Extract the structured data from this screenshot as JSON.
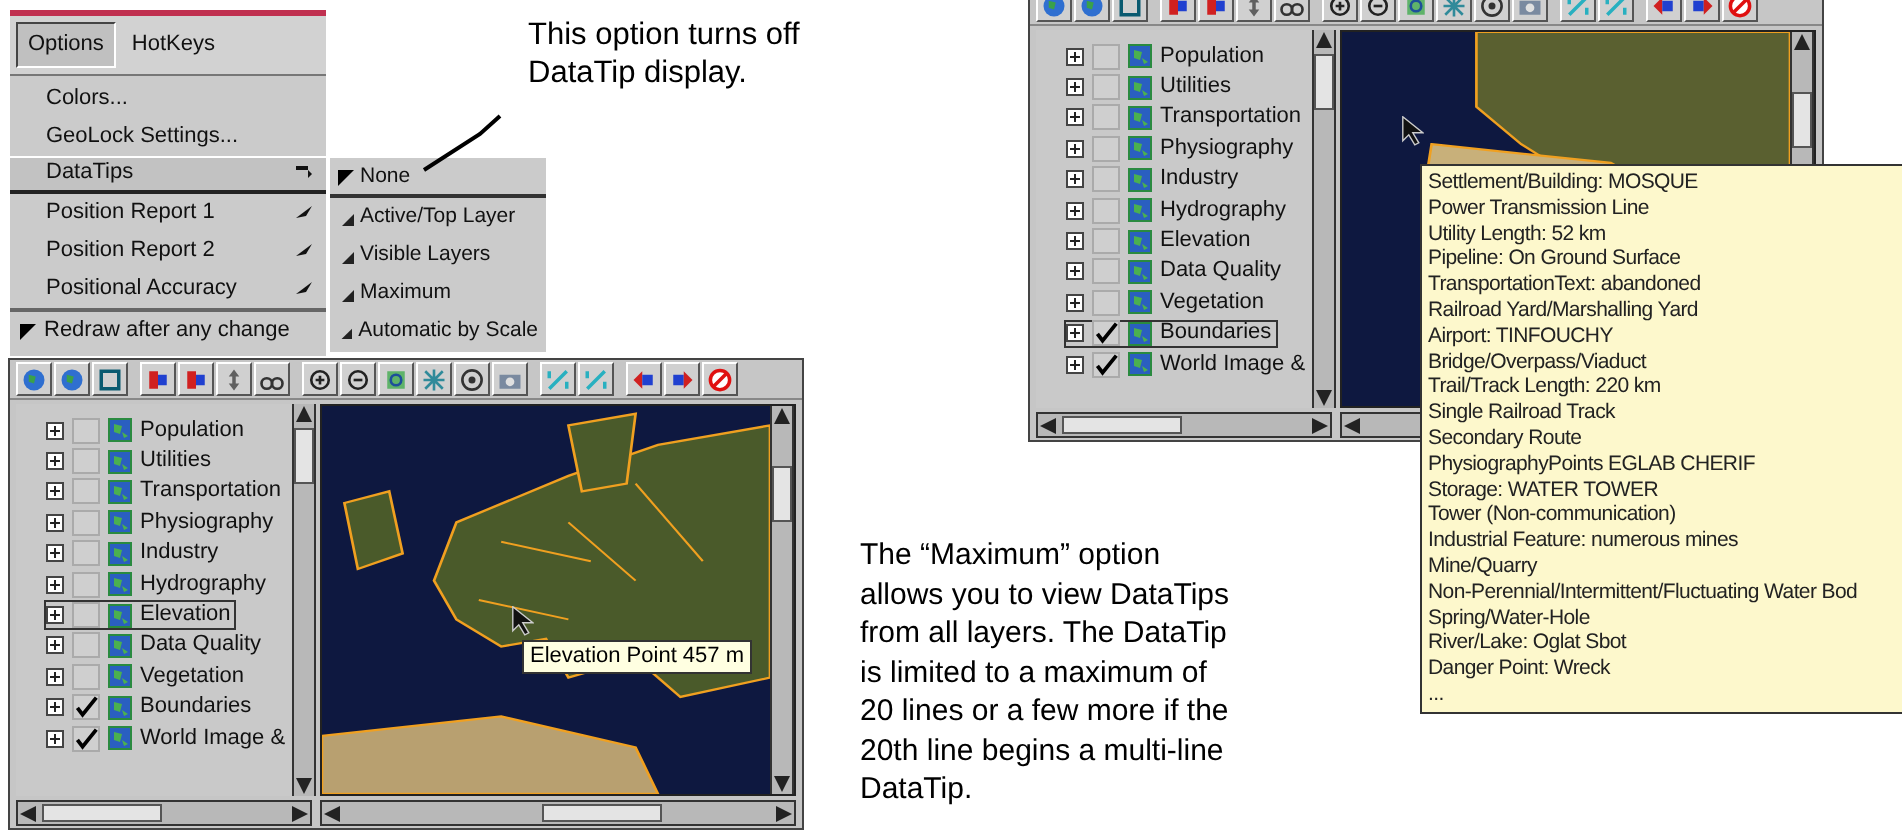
{
  "menu": {
    "menubar": [
      {
        "label": "Options",
        "selected": true
      },
      {
        "label": "HotKeys",
        "selected": false
      }
    ],
    "items": [
      {
        "kind": "item",
        "label": "Colors...",
        "selected": false
      },
      {
        "kind": "item",
        "label": "GeoLock Settings...",
        "selected": false
      },
      {
        "kind": "submenu",
        "label": "DataTips",
        "selected": true
      },
      {
        "kind": "submenu",
        "label": "Position Report 1",
        "selected": false
      },
      {
        "kind": "submenu",
        "label": "Position Report 2",
        "selected": false
      },
      {
        "kind": "submenu",
        "label": "Positional Accuracy",
        "selected": false
      },
      {
        "kind": "check",
        "label": "Redraw after any change",
        "checked": true
      }
    ]
  },
  "submenu": [
    {
      "label": "None",
      "checked": true
    },
    {
      "label": "Active/Top Layer",
      "checked": false
    },
    {
      "label": "Visible Layers",
      "checked": false
    },
    {
      "label": "Maximum",
      "checked": false
    },
    {
      "label": "Automatic by Scale",
      "checked": false
    }
  ],
  "callout_top": "This option turns off DataTip display.",
  "window_bottom": {
    "layers": [
      {
        "name": "Population",
        "checked": false,
        "selected": false
      },
      {
        "name": "Utilities",
        "checked": false,
        "selected": false
      },
      {
        "name": "Transportation",
        "checked": false,
        "selected": false
      },
      {
        "name": "Physiography",
        "checked": false,
        "selected": false
      },
      {
        "name": "Industry",
        "checked": false,
        "selected": false
      },
      {
        "name": "Hydrography",
        "checked": false,
        "selected": false
      },
      {
        "name": "Elevation",
        "checked": false,
        "selected": true
      },
      {
        "name": "Data Quality",
        "checked": false,
        "selected": false
      },
      {
        "name": "Vegetation",
        "checked": false,
        "selected": false
      },
      {
        "name": "Boundaries",
        "checked": true,
        "selected": false
      },
      {
        "name": "World Image &",
        "checked": true,
        "selected": false
      }
    ],
    "datatip": [
      "Elevation Point 457 m"
    ]
  },
  "window_top": {
    "layers": [
      {
        "name": "Population",
        "checked": false,
        "selected": false
      },
      {
        "name": "Utilities",
        "checked": false,
        "selected": false
      },
      {
        "name": "Transportation",
        "checked": false,
        "selected": false
      },
      {
        "name": "Physiography",
        "checked": false,
        "selected": false
      },
      {
        "name": "Industry",
        "checked": false,
        "selected": false
      },
      {
        "name": "Hydrography",
        "checked": false,
        "selected": false
      },
      {
        "name": "Elevation",
        "checked": false,
        "selected": false
      },
      {
        "name": "Data Quality",
        "checked": false,
        "selected": false
      },
      {
        "name": "Vegetation",
        "checked": false,
        "selected": false
      },
      {
        "name": "Boundaries",
        "checked": true,
        "selected": true
      },
      {
        "name": "World Image &",
        "checked": true,
        "selected": false
      }
    ],
    "datatip": [
      "Settlement/Building: MOSQUE",
      "Power Transmission Line",
      "Utility Length: 52 km",
      "Pipeline: On Ground Surface",
      "TransportationText: abandoned",
      "Railroad Yard/Marshalling Yard",
      "Airport: TINFOUCHY",
      "Bridge/Overpass/Viaduct",
      "Trail/Track Length: 220 km",
      "Single Railroad Track",
      "Secondary Route",
      "PhysiographyPoints EGLAB CHERIF",
      "Storage: WATER TOWER",
      "Tower (Non-communication)",
      "Industrial Feature: numerous mines",
      "Mine/Quarry",
      "Non-Perennial/Intermittent/Fluctuating Water Bod",
      "Spring/Water-Hole",
      "River/Lake: Oglat Sbot",
      "Danger Point: Wreck",
      "..."
    ]
  },
  "callout_bottom": "The “Maximum” option allows you to view DataTips from all layers. The DataTip is limited to a maximum of 20 lines or a few more if the 20th line begins a multi-line DataTip."
}
